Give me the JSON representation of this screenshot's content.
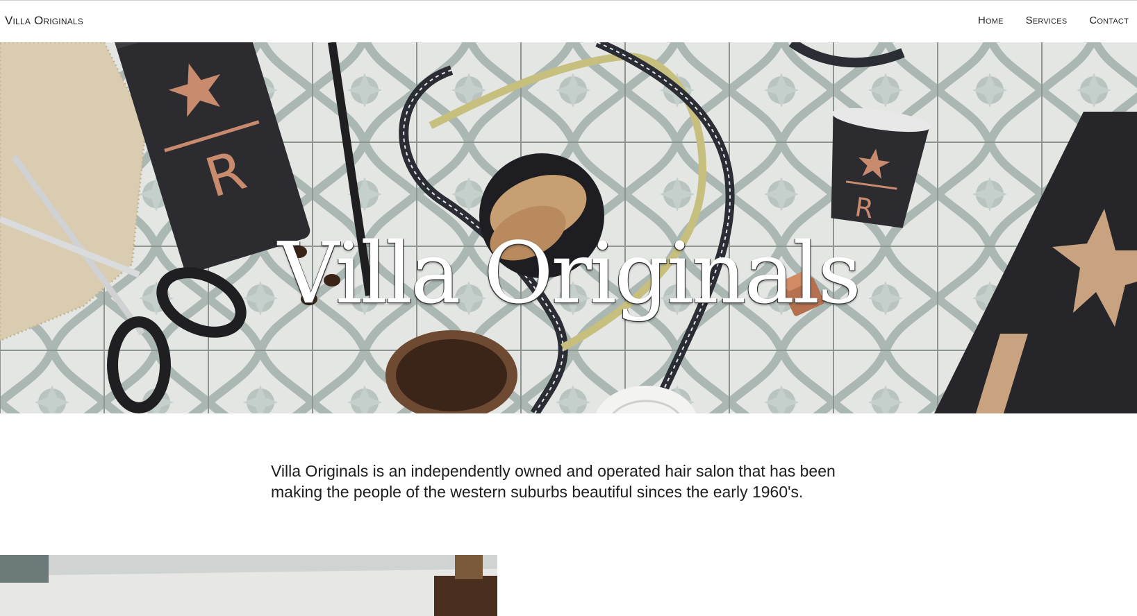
{
  "nav": {
    "brand": "Villa Originals",
    "links": [
      "Home",
      "Services",
      "Contact"
    ]
  },
  "hero": {
    "title": "Villa Originals"
  },
  "intro": {
    "text": "Villa Originals is an independently owned and operated hair salon that has been making the people of the western suburbs beautiful sinces the early 1960's."
  },
  "colors": {
    "tile_light": "#e4e6e3",
    "tile_pattern": "#aab7b3",
    "cup_dark": "#2c2c30",
    "accent_copper": "#c98b6d",
    "ribbon_gold": "#c7bf7e"
  }
}
